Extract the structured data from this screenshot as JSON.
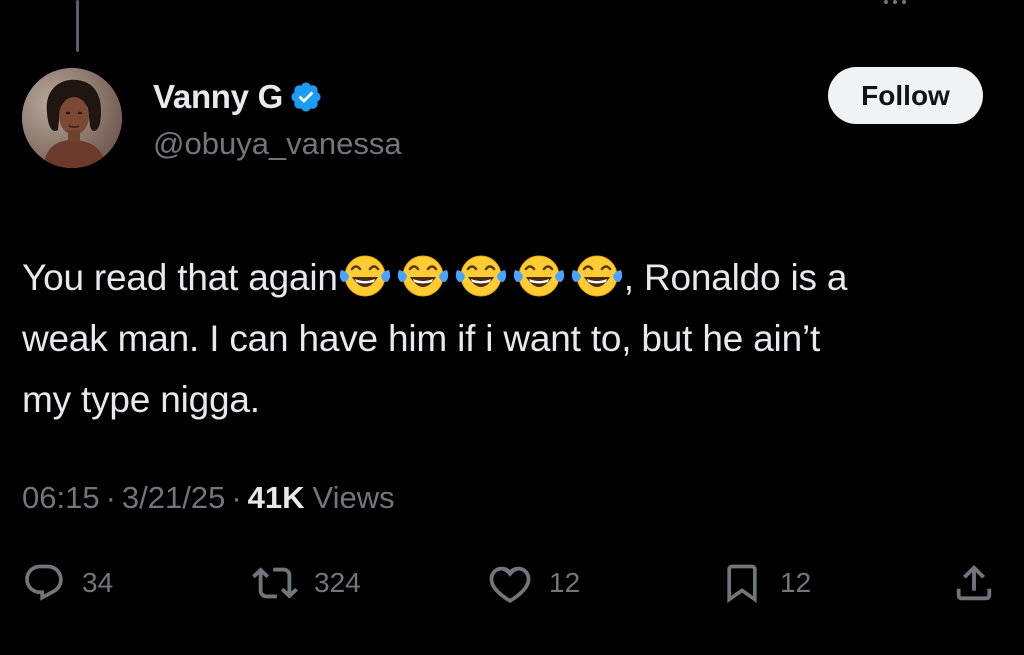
{
  "tweet": {
    "author": {
      "display_name": "Vanny G",
      "handle": "@obuya_vanessa",
      "verified": true
    },
    "follow_label": "Follow",
    "text": {
      "line1_prefix": "You read that again",
      "emoji": "face-with-tears-of-joy",
      "emoji_count": 5,
      "line1_suffix": ", Ronaldo is a",
      "line2": "weak man. I can  have him if i want to,  but he ain’t",
      "line3": "my type nigga."
    },
    "meta": {
      "time": "06:15",
      "separator": "·",
      "date": "3/21/25",
      "views_count": "41K",
      "views_label": "Views"
    },
    "actions": {
      "replies": "34",
      "reposts": "324",
      "likes": "12",
      "bookmarks": "12"
    }
  },
  "colors": {
    "background": "#000000",
    "primary_text": "#e7e9ea",
    "secondary_text": "#71767b",
    "verified_blue": "#1d9bf0",
    "follow_bg": "#eff3f4"
  },
  "icons": [
    "verified-badge-icon",
    "reply-icon",
    "repost-icon",
    "like-icon",
    "bookmark-icon",
    "share-icon"
  ]
}
